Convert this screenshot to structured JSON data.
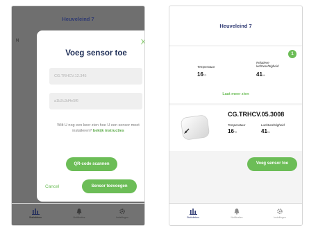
{
  "left_screen": {
    "header_title": "Heuveleind 7",
    "background_text": "N",
    "modal": {
      "close_label": "X",
      "title": "Voeg sensor toe",
      "sensor_id_value": "CG.TRHCV.12.345",
      "sensor_code_value": "a1b2c3d4e5f6",
      "help_text": "Wilt U nog een keer zien hoe U een sensor moet installeren?",
      "help_link": "bekijk instructies",
      "qr_button_label": "QR-code scannen",
      "cancel_label": "Cancel",
      "add_button_label": "Sensor toevoegen"
    },
    "tabbar": {
      "items": [
        {
          "label": "Statistieken",
          "icon": "bar-chart-icon",
          "active": true
        },
        {
          "label": "Notificaties",
          "icon": "bell-icon",
          "active": false
        },
        {
          "label": "Instellingen",
          "icon": "gear-icon",
          "active": false
        }
      ]
    }
  },
  "right_screen": {
    "header_title": "Heuveleind 7",
    "room_card": {
      "badge": "1",
      "temperature_label": "Temperatuur",
      "temperature_value": "16",
      "temperature_unit": "°C",
      "humidity_label": "Relatieve luchtvochtigheid",
      "humidity_value": "41",
      "humidity_unit": "%",
      "more_link": "Laat meer zien"
    },
    "sensor_card": {
      "name": "CG.TRHCV.05.3008",
      "temperature_label": "Temperatuur",
      "temperature_value": "16",
      "temperature_unit": "°C",
      "humidity_label": "Luchtvochtigheid",
      "humidity_value": "41",
      "humidity_unit": "%"
    },
    "add_button_label": "Voeg sensor toe",
    "tabbar": {
      "items": [
        {
          "label": "Statistieken",
          "icon": "bar-chart-icon",
          "active": true
        },
        {
          "label": "Notificaties",
          "icon": "bell-icon",
          "active": false
        },
        {
          "label": "Instellingen",
          "icon": "gear-icon",
          "active": false
        }
      ]
    }
  },
  "colors": {
    "accent_green": "#6cbd57",
    "header_navy": "#2f3a73",
    "overlay_gray": "#6f6f6f"
  }
}
